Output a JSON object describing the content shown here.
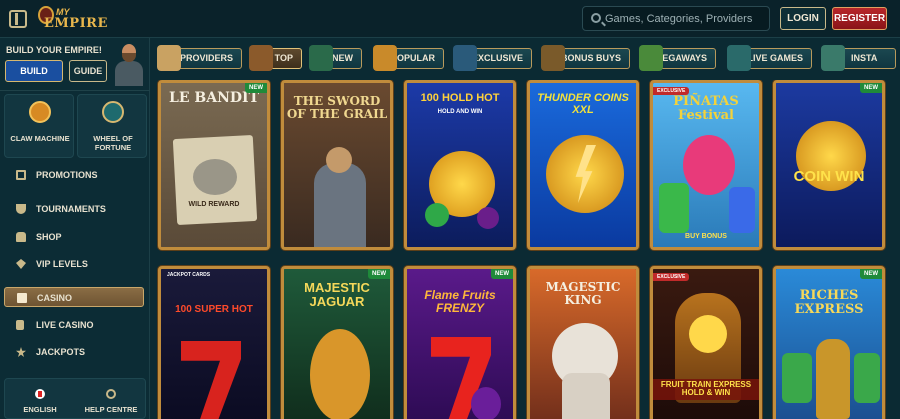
{
  "header": {
    "logo": {
      "my": "MY",
      "empire": "EMPIRE"
    },
    "search_placeholder": "Games, Categories, Providers",
    "login_label": "LOGIN",
    "register_label": "REGISTER"
  },
  "sidebar": {
    "build_title": "BUILD YOUR EMPIRE!",
    "build_label": "BUILD",
    "guide_label": "GUIDE",
    "tiles": [
      {
        "label": "CLAW MACHINE",
        "icon": "claw-machine-icon"
      },
      {
        "label": "WHEEL OF FORTUNE",
        "icon": "wheel-of-fortune-icon"
      }
    ],
    "items": [
      {
        "label": "PROMOTIONS",
        "icon": "gift-icon"
      },
      {
        "label": "TOURNAMENTS",
        "icon": "trophy-icon"
      },
      {
        "label": "SHOP",
        "icon": "shop-bag-icon"
      },
      {
        "label": "VIP LEVELS",
        "icon": "diamond-icon"
      },
      {
        "label": "CASINO",
        "icon": "casino-icon",
        "active": true
      },
      {
        "label": "LIVE CASINO",
        "icon": "live-casino-icon"
      },
      {
        "label": "JACKPOTS",
        "icon": "jackpot-icon"
      }
    ],
    "bottom": {
      "language_label": "ENGLISH",
      "help_label": "HELP CENTRE"
    }
  },
  "categories": [
    {
      "label": "PROVIDERS",
      "icon": "providers-scroll-icon"
    },
    {
      "label": "TOP",
      "icon": "top-chest-icon",
      "active": true
    },
    {
      "label": "NEW",
      "icon": "new-lightning-icon"
    },
    {
      "label": "POPULAR",
      "icon": "popular-icon"
    },
    {
      "label": "EXCLUSIVE",
      "icon": "exclusive-icon"
    },
    {
      "label": "BONUS BUYS",
      "icon": "bonus-buys-icon"
    },
    {
      "label": "MEGAWAYS",
      "icon": "megaways-icon"
    },
    {
      "label": "LIVE GAMES",
      "icon": "live-games-icon"
    },
    {
      "label": "INSTA",
      "icon": "insta-icon"
    }
  ],
  "games": [
    {
      "title": "LE BANDIT",
      "badge": "NEW",
      "extra": "WILD REWARD"
    },
    {
      "title": "THE SWORD OF THE GRAIL",
      "badge": ""
    },
    {
      "title": "100 HOLD HOT",
      "badge": "",
      "extra": "HOLD AND WIN"
    },
    {
      "title": "THUNDER COINS XXL",
      "badge": ""
    },
    {
      "title": "PIÑATAS Festival",
      "badge": "EXCLUSIVE",
      "extra": "BUY BONUS"
    },
    {
      "title": "COIN WIN",
      "badge": "NEW"
    },
    {
      "title": "100 SUPER HOT",
      "badge": "",
      "extra": "JACKPOT CARDS"
    },
    {
      "title": "MAJESTIC JAGUAR",
      "badge": "NEW"
    },
    {
      "title": "Flame Fruits FRENZY",
      "badge": "NEW"
    },
    {
      "title": "MAGESTIC KING",
      "badge": ""
    },
    {
      "title": "FRUIT TRAIN EXPRESS HOLD & WIN",
      "badge": "EXCLUSIVE"
    },
    {
      "title": "RICHES EXPRESS",
      "badge": "NEW"
    }
  ]
}
